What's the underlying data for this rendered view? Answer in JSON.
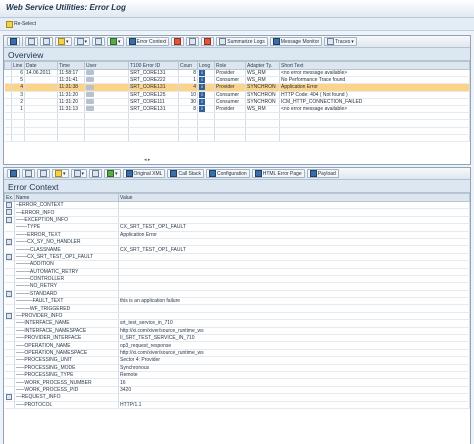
{
  "window": {
    "title": "Web Service Utilities: Error Log"
  },
  "reselect": {
    "label": "Re-Select"
  },
  "overview": {
    "toolbar": {
      "buttons": [
        "Error Context",
        "Summarize Logs",
        "Message Monitor",
        "Traces"
      ]
    },
    "title": "Overview",
    "columns": [
      "Line",
      "Date",
      "Time",
      "User",
      "T100 Error ID",
      "Coun",
      "Long",
      "Role",
      "Adapter Ty.",
      "Short Text"
    ],
    "rows": [
      {
        "line": "6",
        "date": "14.06.2011",
        "time": "11:58:17",
        "error_id": "SRT_CORE131",
        "count": "8",
        "role": "Provider",
        "adapter": "WS_RM",
        "text": "<no error message available>"
      },
      {
        "line": "5",
        "date": "",
        "time": "11:31:41",
        "error_id": "SRT_CORE222",
        "count": "1",
        "role": "Consumer",
        "adapter": "WS_RM",
        "text": "No Performance Trace found"
      },
      {
        "line": "4",
        "date": "",
        "time": "11:31:38",
        "error_id": "SRT_CORE131",
        "count": "4",
        "role": "Provider",
        "adapter": "SYNCHRON",
        "text": "Application Error"
      },
      {
        "line": "3",
        "date": "",
        "time": "11:31:20",
        "error_id": "SRT_CORE125",
        "count": "10",
        "role": "Consumer",
        "adapter": "SYNCHRON",
        "text": "HTTP Code: 404 ( Not found )"
      },
      {
        "line": "2",
        "date": "",
        "time": "11:31:20",
        "error_id": "SRT_CORE111",
        "count": "30",
        "role": "Consumer",
        "adapter": "SYNCHRON",
        "text": "ICM_HTTP_CONNECTION_FAILED"
      },
      {
        "line": "1",
        "date": "",
        "time": "11:31:13",
        "error_id": "SRT_CORE131",
        "count": "8",
        "role": "Provider",
        "adapter": "WS_RM",
        "text": "<no error message available>"
      }
    ],
    "selected_line": "4"
  },
  "error_context": {
    "toolbar": {
      "buttons": [
        "Original XML",
        "Call Stack",
        "Configuration",
        "HTML Error Page",
        "Payload"
      ]
    },
    "title": "Error Context",
    "columns": [
      "Ex.",
      "Name",
      "Value"
    ],
    "rows": [
      {
        "name": "–ERROR_CONTEXT",
        "value": "",
        "exp": true
      },
      {
        "name": "––ERROR_INFO",
        "value": "",
        "exp": true
      },
      {
        "name": "–––EXCEPTION_INFO",
        "value": "",
        "exp": true
      },
      {
        "name": "––––TYPE",
        "value": "CX_SRT_TEST_OP1_FAULT",
        "exp": false
      },
      {
        "name": "––––ERROR_TEXT",
        "value": "Application Error",
        "exp": false
      },
      {
        "name": "––––CX_SY_NO_HANDLER",
        "value": "",
        "exp": true
      },
      {
        "name": "–––––CLASSNAME",
        "value": "CX_SRT_TEST_OP1_FAULT",
        "exp": false
      },
      {
        "name": "––––CX_SRT_TEST_OP1_FAULT",
        "value": "",
        "exp": true
      },
      {
        "name": "–––––ADDITION",
        "value": "",
        "exp": false
      },
      {
        "name": "–––––AUTOMATIC_RETRY",
        "value": "",
        "exp": false
      },
      {
        "name": "–––––CONTROLLER",
        "value": "",
        "exp": false
      },
      {
        "name": "–––––NO_RETRY",
        "value": "",
        "exp": false
      },
      {
        "name": "–––––STANDARD",
        "value": "",
        "exp": true
      },
      {
        "name": "––––––FAULT_TEXT",
        "value": "this is an application failure",
        "exp": false
      },
      {
        "name": "–––––WF_TRIGGERED",
        "value": "",
        "exp": false
      },
      {
        "name": "––PROVIDER_INFO",
        "value": "",
        "exp": true
      },
      {
        "name": "–––INTERFACE_NAME",
        "value": "srt_test_service_in_710",
        "exp": false
      },
      {
        "name": "–––INTERFACE_NAMESPACE",
        "value": "http://xi.com/xiver/source_runtime_ws",
        "exp": false
      },
      {
        "name": "–––PROVIDER_INTERFACE",
        "value": "II_SRT_TEST_SERVICE_IN_710",
        "exp": false
      },
      {
        "name": "–––OPERATION_NAME",
        "value": "op3_request_response",
        "exp": false
      },
      {
        "name": "–––OPERATION_NAMESPACE",
        "value": "http://xi.com/xiver/source_runtime_ws",
        "exp": false
      },
      {
        "name": "–––PROCESSING_UNIT",
        "value": "Sector 4: Provider",
        "exp": false
      },
      {
        "name": "–––PROCESSING_MODE",
        "value": "Synchronous",
        "exp": false
      },
      {
        "name": "–––PROCESSING_TYPE",
        "value": "Remote",
        "exp": false
      },
      {
        "name": "–––WORK_PROCESS_NUMBER",
        "value": "16",
        "exp": false
      },
      {
        "name": "–––WORK_PROCESS_PID",
        "value": "3420",
        "exp": false
      },
      {
        "name": "––REQUEST_INFO",
        "value": "",
        "exp": true
      },
      {
        "name": "–––PROTOCOL",
        "value": "HTTP/1.1",
        "exp": false
      }
    ]
  },
  "colors": {
    "selected_row": "#fbd48a",
    "header_bg": "#dde7f2",
    "accent": "#2f5f9a"
  }
}
